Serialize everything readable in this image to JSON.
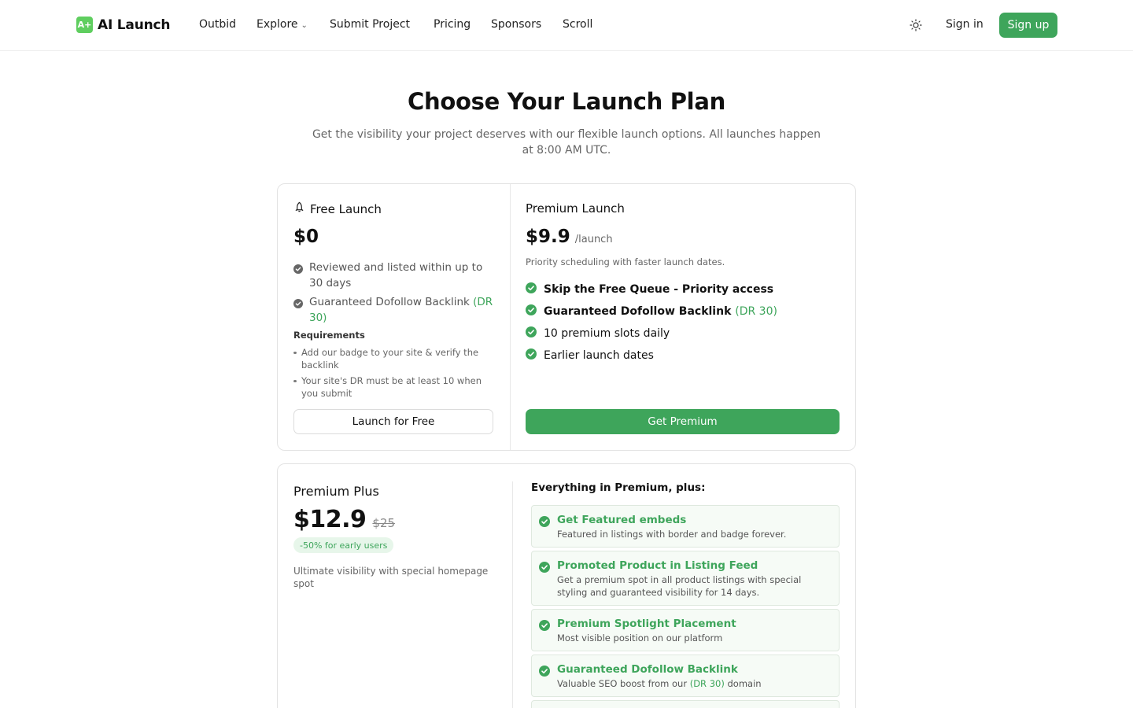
{
  "header": {
    "logo_mark": "A+",
    "logo_text": "AI Launch",
    "nav": [
      "Outbid",
      "Explore",
      "Submit Project",
      "Pricing",
      "Sponsors",
      "Scroll"
    ],
    "signin": "Sign in",
    "signup": "Sign up"
  },
  "hero": {
    "title": "Choose Your Launch Plan",
    "subtitle": "Get the visibility your project deserves with our flexible launch options. All launches happen at 8:00 AM UTC."
  },
  "free": {
    "title": "Free Launch",
    "price": "$0",
    "features": [
      {
        "text": "Reviewed and listed within up to 30 days",
        "extra": ""
      },
      {
        "text": "Guaranteed Dofollow Backlink ",
        "extra": "(DR 30)"
      }
    ],
    "requirements_title": "Requirements",
    "requirements": [
      "Add our badge to your site & verify the backlink",
      "Your site's DR must be at least 10 when you submit"
    ],
    "button": "Launch for Free"
  },
  "premium": {
    "title": "Premium Launch",
    "price": "$9.9",
    "per": "/launch",
    "description": "Priority scheduling with faster launch dates.",
    "features": [
      {
        "text": "Skip the Free Queue - Priority access",
        "extra": "",
        "bold": true
      },
      {
        "text": "Guaranteed Dofollow Backlink ",
        "extra": "(DR 30)",
        "bold": true
      },
      {
        "text": "10 premium slots daily",
        "extra": "",
        "bold": false
      },
      {
        "text": "Earlier launch dates",
        "extra": "",
        "bold": false
      }
    ],
    "button": "Get Premium"
  },
  "premium_plus": {
    "title": "Premium Plus",
    "price": "$12.9",
    "old_price": "$25",
    "badge": "-50% for early users",
    "description": "Ultimate visibility with special homepage spot",
    "right_title": "Everything in Premium, plus:",
    "items": [
      {
        "title": "Get Featured embeds",
        "desc": "Featured in listings with border and badge forever."
      },
      {
        "title": "Promoted Product in Listing Feed",
        "desc": "Get a premium spot in all product listings with special styling and guaranteed visibility for 14 days."
      },
      {
        "title": "Premium Spotlight Placement",
        "desc": "Most visible position on our platform"
      },
      {
        "title": "Guaranteed Dofollow Backlink",
        "desc_pre": "Valuable SEO boost from our ",
        "desc_dr": "(DR 30)",
        "desc_post": " domain"
      }
    ]
  },
  "colors": {
    "accent": "#3ea55b",
    "logo": "#5fce5f",
    "border": "#e3e3e3"
  }
}
